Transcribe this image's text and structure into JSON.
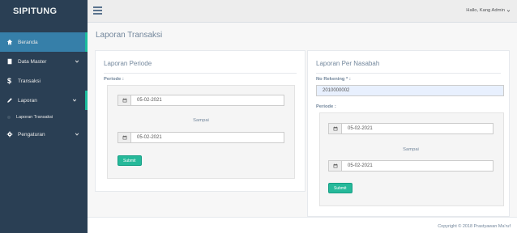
{
  "brand": "SIPITUNG",
  "user": {
    "greeting": "Hallo, Kang Admin"
  },
  "sidebar": {
    "items": [
      {
        "label": "Beranda",
        "icon": "home-icon"
      },
      {
        "label": "Data Master",
        "icon": "book-icon"
      },
      {
        "label": "Transaksi",
        "icon": "dollar-icon"
      },
      {
        "label": "Laporan",
        "icon": "pencil-icon"
      },
      {
        "label": "Pengaturan",
        "icon": "gear-icon"
      }
    ],
    "subitems": [
      {
        "label": "Laporan Transaksi"
      }
    ]
  },
  "page": {
    "title": "Laporan Transaksi"
  },
  "periode_panel": {
    "title": "Laporan Periode",
    "periode_label": "Periode :",
    "date_from": "05-02-2021",
    "sampai": "Sampai",
    "date_to": "05-02-2021",
    "submit": "Submit"
  },
  "nasabah_panel": {
    "title": "Laporan Per Nasabah",
    "rekening_label": "No Rekening * :",
    "rekening_value": "2010000002",
    "periode_label": "Periode :",
    "date_from": "05-02-2021",
    "sampai": "Sampai",
    "date_to": "05-02-2021",
    "submit": "Submit"
  },
  "footer": {
    "text": "Copyright © 2018 Prastyawan Ma'ruf"
  },
  "colors": {
    "sidebar": "#2a3f54",
    "active": "#367fa9",
    "accent": "#1abb9c",
    "button": "#26b99a"
  }
}
